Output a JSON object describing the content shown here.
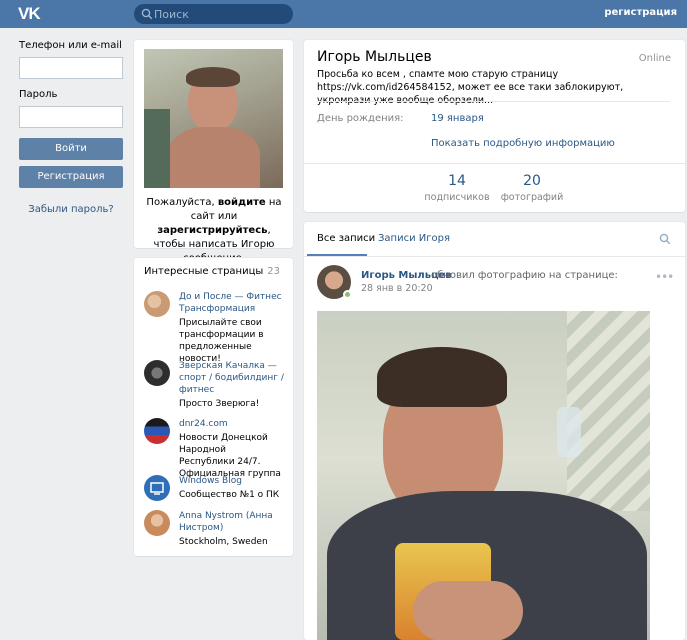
{
  "topbar": {
    "logo": "VK",
    "search_placeholder": "Поиск",
    "register_link": "регистрация"
  },
  "login": {
    "phone_label": "Телефон или e-mail",
    "password_label": "Пароль",
    "login_button": "Войти",
    "register_button": "Регистрация",
    "forgot_link": "Забыли пароль?"
  },
  "profile_card": {
    "note_part1": "Пожалуйста, ",
    "note_login": "войдите",
    "note_part2": " на сайт или ",
    "note_register": "зарегистрируйтесь",
    "note_part3": ", чтобы написать Игорю сообщение."
  },
  "interesting": {
    "title": "Интересные страницы",
    "count": "23",
    "items": [
      {
        "name": "До и После — Фитнес Трансформация",
        "desc": "Присылайте свои трансформации в предложенные новости!",
        "color": "#c99a74"
      },
      {
        "name": "Зверская Качалка — спорт / бодибилдинг / фитнес",
        "desc": "Просто Зверюга!",
        "color": "#3a3a3a"
      },
      {
        "name": "dnr24.com",
        "desc": "Новости Донецкой Народной Республики 24/7. Официальная группа",
        "color": "#d23c3c"
      },
      {
        "name": "Windows Blog",
        "desc": "Сообщество №1 о ПК",
        "color": "#2e6fb8"
      },
      {
        "name": "Anna Nystrom (Анна Нистром)",
        "desc": "Stockholm, Sweden",
        "color": "#d9a27e"
      }
    ]
  },
  "profile": {
    "name": "Игорь Мыльцев",
    "online": "Online",
    "status": "Просьба ко всем , спамте мою старую страницу https://vk.com/id264584152, может ее все таки заблокируют, укромрази уже вообще оборзели...",
    "birthday_label": "День рождения:",
    "birthday_value": "19 января",
    "more_info": "Показать подробную информацию",
    "counters": [
      {
        "num": "14",
        "label": "подписчиков"
      },
      {
        "num": "20",
        "label": "фотографий"
      }
    ]
  },
  "wall": {
    "tabs": [
      "Все записи",
      "Записи Игоря"
    ],
    "post": {
      "author": "Игорь Мыльцев",
      "action": "обновил фотографию на странице:",
      "date": "28 янв в 20:20",
      "menu": "•••"
    }
  }
}
